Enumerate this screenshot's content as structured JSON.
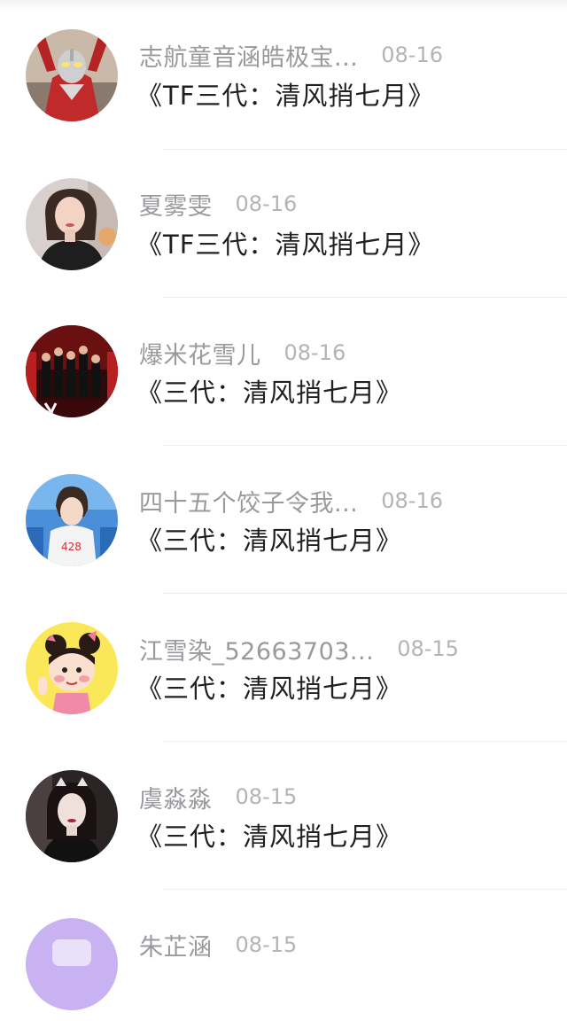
{
  "comments": [
    {
      "username": "志航童音涵皓极宝...",
      "date": "08-16",
      "title": "《TF三代：清风捎七月》",
      "avatar": "red-hero-avatar"
    },
    {
      "username": "夏雾雯",
      "date": "08-16",
      "title": "《TF三代：清风捎七月》",
      "avatar": "woman-portrait-avatar"
    },
    {
      "username": "爆米花雪儿",
      "date": "08-16",
      "title": "《三代：清风捎七月》",
      "avatar": "stage-group-avatar"
    },
    {
      "username": "四十五个饺子令我...",
      "date": "08-16",
      "title": "《三代：清风捎七月》",
      "avatar": "boy-stage-avatar"
    },
    {
      "username": "江雪染_52663703...",
      "date": "08-15",
      "title": "《三代：清风捎七月》",
      "avatar": "cartoon-girl-avatar"
    },
    {
      "username": "虞淼淼",
      "date": "08-15",
      "title": "《三代：清风捎七月》",
      "avatar": "woman-dark-avatar"
    },
    {
      "username": "朱芷涵",
      "date": "08-15",
      "title": "",
      "avatar": "purple-avatar"
    }
  ]
}
